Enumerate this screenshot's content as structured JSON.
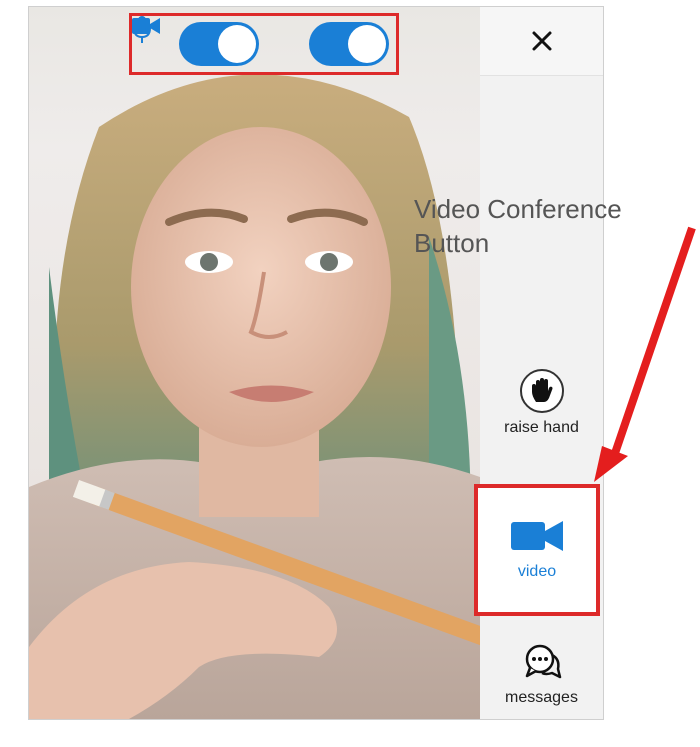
{
  "controls": {
    "camera_icon": "video-camera-icon",
    "mic_icon": "microphone-icon",
    "camera_toggle_on": true,
    "mic_toggle_on": true
  },
  "sidebar": {
    "close_icon": "close-icon",
    "raise_hand": {
      "label": "raise hand",
      "icon": "hand-icon"
    },
    "video": {
      "label": "video",
      "icon": "video-camera-icon"
    },
    "messages": {
      "label": "messages",
      "icon": "chat-bubbles-icon"
    }
  },
  "annotation": {
    "text_line1": "Video Conference",
    "text_line2": "Button",
    "color": "#dd2a2a"
  },
  "colors": {
    "accent": "#1a7fd6",
    "highlight": "#dd2a2a"
  }
}
